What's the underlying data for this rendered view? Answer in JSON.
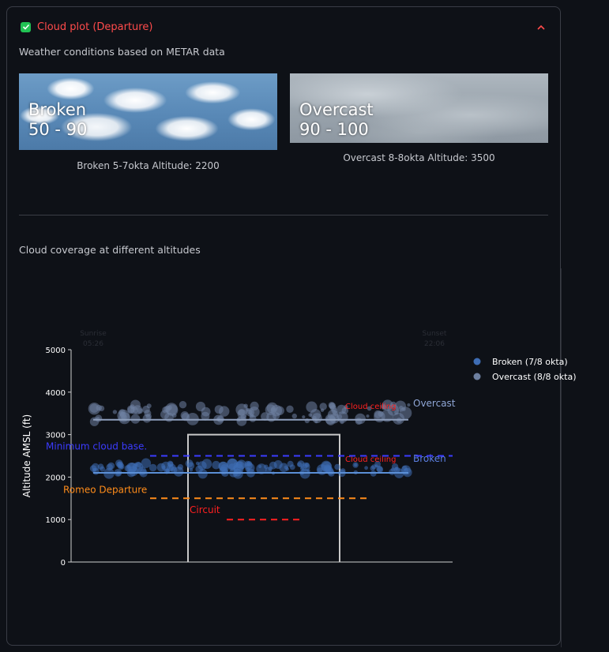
{
  "expander": {
    "title": "Cloud plot (Departure)",
    "checked": true
  },
  "caption_weather": "Weather conditions based on METAR data",
  "images": [
    {
      "title_line1": "Broken",
      "title_line2": "50 - 90",
      "caption": "Broken 5-7okta Altitude: 2200"
    },
    {
      "title_line1": "Overcast",
      "title_line2": "90 - 100",
      "caption": "Overcast 8-8okta Altitude: 3500"
    }
  ],
  "caption_coverage": "Cloud coverage at different altitudes",
  "chart_data": {
    "type": "scatter",
    "ylabel": "Altitude AMSL (ft)",
    "ylim": [
      0,
      5000
    ],
    "yticks": [
      "0",
      "1000",
      "2000",
      "3000",
      "4000",
      "5000"
    ],
    "sunrise": {
      "label": "Sunrise",
      "time": "05:26"
    },
    "sunset": {
      "label": "Sunset",
      "time": "22:06"
    },
    "series": [
      {
        "name": "Broken (7/8 okta)",
        "color": "#3e6db5",
        "altitude": 2200,
        "band_label": "Broken"
      },
      {
        "name": "Overcast (8/8 okta)",
        "color": "#6d7fa0",
        "altitude": 3500,
        "band_label": "Overcast"
      }
    ],
    "cloud_ceiling_label": "Cloud ceiling",
    "lines": [
      {
        "label": "Minimum cloud base.",
        "altitude": 2500,
        "color": "#3b3bff",
        "style": "dashed"
      },
      {
        "label": "Romeo Departure",
        "altitude": 1500,
        "color": "#ff8c1a",
        "style": "dashed"
      },
      {
        "label": "Circuit",
        "altitude": 1000,
        "color": "#ff2020",
        "style": "dashed"
      }
    ],
    "circuit_box": {
      "top_altitude": 3000,
      "color": "#c8c8c8"
    },
    "legend_position": "top-right"
  }
}
